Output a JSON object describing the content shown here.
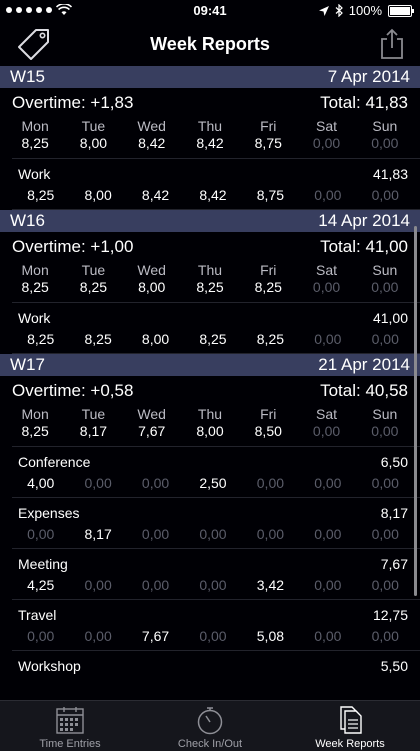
{
  "status": {
    "time": "09:41",
    "battery": "100%"
  },
  "nav": {
    "title": "Week Reports"
  },
  "days": [
    "Mon",
    "Tue",
    "Wed",
    "Thu",
    "Fri",
    "Sat",
    "Sun"
  ],
  "weeks": [
    {
      "week": "W15",
      "date": "7 Apr 2014",
      "overtime": "Overtime: +1,83",
      "total": "Total:  41,83",
      "values": [
        "8,25",
        "8,00",
        "8,42",
        "8,42",
        "8,75",
        "0,00",
        "0,00"
      ],
      "tasks": [
        {
          "name": "Work",
          "total": "41,83",
          "values": [
            "8,25",
            "8,00",
            "8,42",
            "8,42",
            "8,75",
            "0,00",
            "0,00"
          ]
        }
      ]
    },
    {
      "week": "W16",
      "date": "14 Apr 2014",
      "overtime": "Overtime: +1,00",
      "total": "Total:  41,00",
      "values": [
        "8,25",
        "8,25",
        "8,00",
        "8,25",
        "8,25",
        "0,00",
        "0,00"
      ],
      "tasks": [
        {
          "name": "Work",
          "total": "41,00",
          "values": [
            "8,25",
            "8,25",
            "8,00",
            "8,25",
            "8,25",
            "0,00",
            "0,00"
          ]
        }
      ]
    },
    {
      "week": "W17",
      "date": "21 Apr 2014",
      "overtime": "Overtime: +0,58",
      "total": "Total:  40,58",
      "values": [
        "8,25",
        "8,17",
        "7,67",
        "8,00",
        "8,50",
        "0,00",
        "0,00"
      ],
      "tasks": [
        {
          "name": "Conference",
          "total": "6,50",
          "values": [
            "4,00",
            "0,00",
            "0,00",
            "2,50",
            "0,00",
            "0,00",
            "0,00"
          ]
        },
        {
          "name": "Expenses",
          "total": "8,17",
          "values": [
            "0,00",
            "8,17",
            "0,00",
            "0,00",
            "0,00",
            "0,00",
            "0,00"
          ]
        },
        {
          "name": "Meeting",
          "total": "7,67",
          "values": [
            "4,25",
            "0,00",
            "0,00",
            "0,00",
            "3,42",
            "0,00",
            "0,00"
          ]
        },
        {
          "name": "Travel",
          "total": "12,75",
          "values": [
            "0,00",
            "0,00",
            "7,67",
            "0,00",
            "5,08",
            "0,00",
            "0,00"
          ]
        },
        {
          "name": "Workshop",
          "total": "5,50",
          "values": [
            "",
            "",
            "",
            "",
            "",
            "",
            ""
          ]
        }
      ]
    }
  ],
  "tabs": [
    {
      "label": "Time Entries",
      "icon": "calendar-icon"
    },
    {
      "label": "Check In/Out",
      "icon": "stopwatch-icon"
    },
    {
      "label": "Week Reports",
      "icon": "documents-icon"
    }
  ]
}
